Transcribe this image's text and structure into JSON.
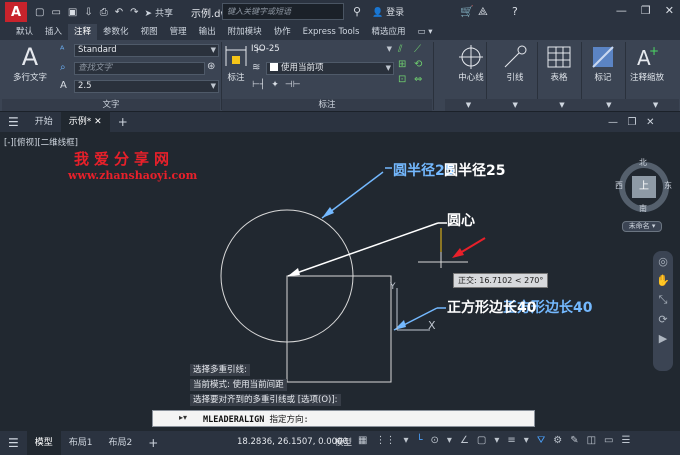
{
  "title_bar": {
    "app_logo": "A",
    "share_label": "共享",
    "document_title": "示例.dwg",
    "search_placeholder": "键入关键字或短语",
    "login_label": "登录",
    "help_label": "?"
  },
  "ribbon_tabs": [
    "默认",
    "插入",
    "注释",
    "参数化",
    "视图",
    "管理",
    "输出",
    "附加模块",
    "协作",
    "Express Tools",
    "精选应用"
  ],
  "active_ribbon_tab": "注释",
  "ribbon": {
    "text_panel": {
      "title": "文字",
      "multiline_text_label": "多行文字",
      "text_style": "Standard",
      "find_text_placeholder": "查找文字",
      "text_height": "2.5"
    },
    "dimension_panel": {
      "title": "标注",
      "dimension_button_label": "标注",
      "dim_style": "ISO-25",
      "layer_combo": "使用当前项"
    },
    "centerline_label": "中心线",
    "leader_label": "引线",
    "table_label": "表格",
    "markup_label": "标记",
    "annotation_scale_label": "注释缩放"
  },
  "file_tabs": {
    "start_label": "开始",
    "active_file_label": "示例*"
  },
  "canvas": {
    "view_label": "[-][俯视][二维线框]",
    "watermark_cn": "我爱分享网",
    "watermark_url": "www.zhanshaoyi.com",
    "annotation_radius": "圆半径25",
    "annotation_center": "圆心",
    "annotation_square": "正方形边长40",
    "snap_tooltip": "正交: 16.7102 < 270°",
    "ucs_y": "Y",
    "ucs_x": "X"
  },
  "command_history": [
    "选择多重引线:",
    "当前模式: 使用当前间距",
    "选择要对齐到的多重引线或 [选项(O)]:"
  ],
  "command_line": {
    "command": "MLEADERALIGN",
    "prompt": "指定方向:"
  },
  "viewcube": {
    "north": "北",
    "south": "南",
    "east": "东",
    "west": "西",
    "face": "上",
    "ucs_label": "未命名"
  },
  "status_bar": {
    "layout_tabs": [
      "模型",
      "布局1",
      "布局2"
    ],
    "active_layout": "模型",
    "coordinates": "18.2836, 26.1507, 0.0000",
    "model_label": "模型"
  },
  "colors": {
    "accent_blue": "#74b9ff",
    "watermark_red": "#e8202a",
    "drawing_line": "#d9d9d9"
  }
}
